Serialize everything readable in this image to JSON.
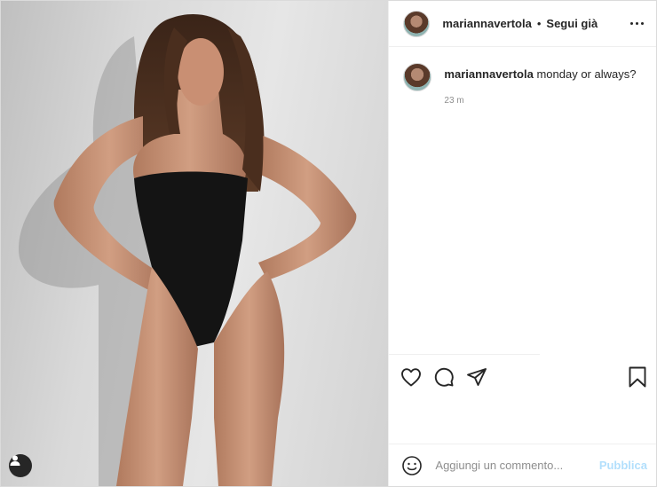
{
  "post": {
    "photo": {
      "icon": "user-tag-icon"
    },
    "header": {
      "username": "mariannavertola",
      "separator": "•",
      "follow_status": "Segui già",
      "more_icon": "more-options-icon"
    },
    "caption": {
      "username": "mariannavertola",
      "text": "monday or always?",
      "time": "23 m"
    },
    "actions": {
      "like_icon": "heart-icon",
      "comment_icon": "comment-icon",
      "share_icon": "share-icon",
      "save_icon": "bookmark-icon"
    },
    "composer": {
      "emoji_icon": "emoji-icon",
      "placeholder": "Aggiungi un commento...",
      "publish_label": "Pubblica",
      "publish_color": "#b2dffc"
    }
  }
}
